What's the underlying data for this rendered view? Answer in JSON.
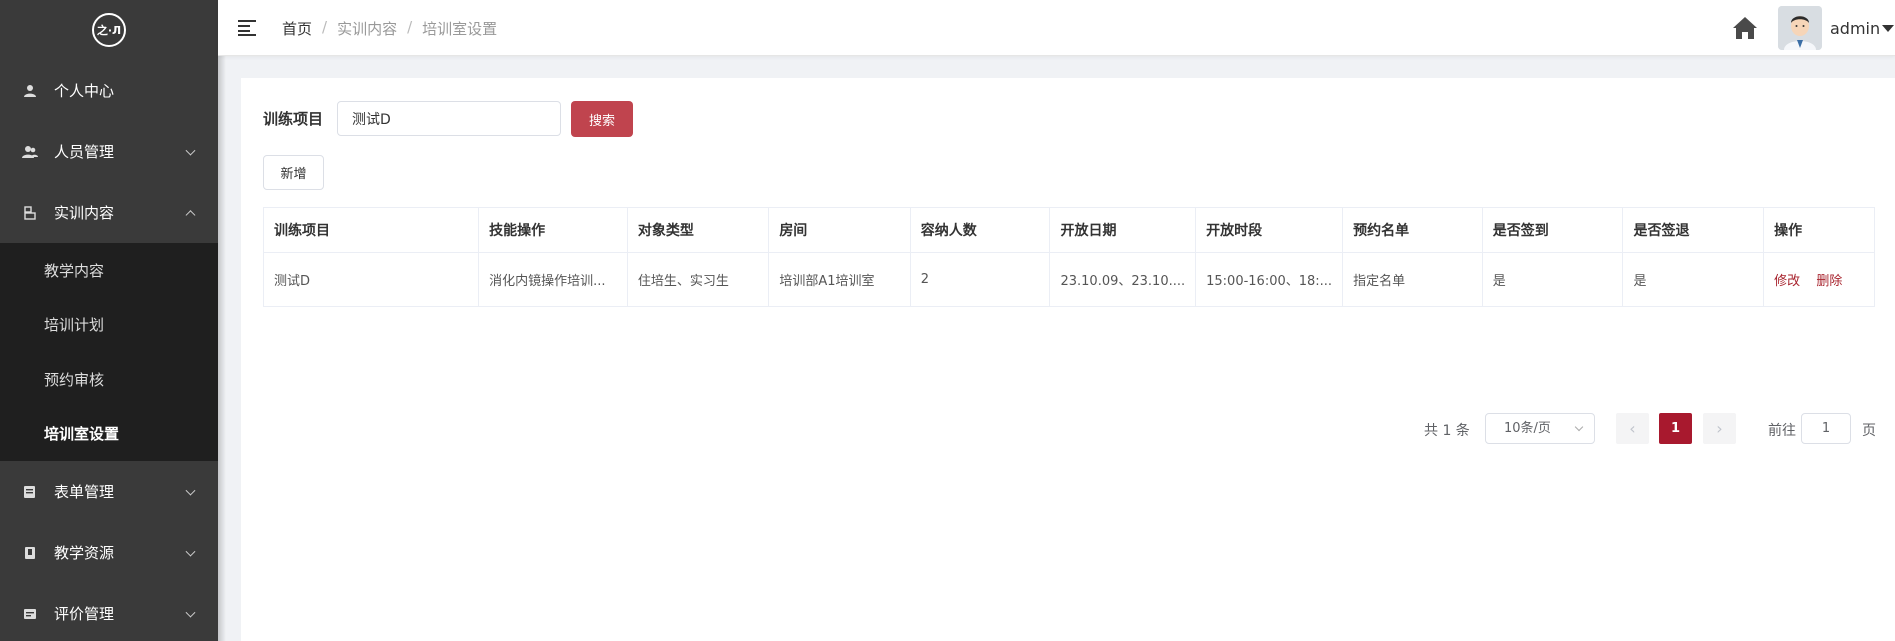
{
  "sidebar": {
    "logo_text": "之·Л",
    "items": [
      {
        "label": "个人中心",
        "icon": "user-icon",
        "has_children": false
      },
      {
        "label": "人员管理",
        "icon": "users-icon",
        "has_children": true
      },
      {
        "label": "实训内容",
        "icon": "training-icon",
        "has_children": true,
        "expanded": true,
        "children": [
          {
            "label": "教学内容"
          },
          {
            "label": "培训计划"
          },
          {
            "label": "预约审核"
          },
          {
            "label": "培训室设置",
            "active": true
          }
        ]
      },
      {
        "label": "表单管理",
        "icon": "form-icon",
        "has_children": true
      },
      {
        "label": "教学资源",
        "icon": "resource-icon",
        "has_children": true
      },
      {
        "label": "评价管理",
        "icon": "evaluation-icon",
        "has_children": true
      }
    ]
  },
  "header": {
    "breadcrumb": [
      "首页",
      "实训内容",
      "培训室设置"
    ],
    "separator": "/",
    "user_name": "admin"
  },
  "search": {
    "label": "训练项目",
    "value": "测试D",
    "search_button": "搜索",
    "add_button": "新增"
  },
  "table": {
    "columns": [
      "训练项目",
      "技能操作",
      "对象类型",
      "房间",
      "容纳人数",
      "开放日期",
      "开放时段",
      "预约名单",
      "是否签到",
      "是否签退",
      "操作"
    ],
    "rows": [
      {
        "cells": [
          "测试D",
          "消化内镜操作培训...",
          "住培生、实习生",
          "培训部A1培训室",
          "2",
          "23.10.09、23.10....",
          "15:00-16:00、18:...",
          "指定名单",
          "是",
          "是"
        ],
        "actions": [
          "修改",
          "删除"
        ]
      }
    ]
  },
  "pagination": {
    "total_text": "共 1 条",
    "page_size": "10条/页",
    "current_page": "1",
    "goto_label": "前往",
    "goto_value": "1",
    "page_suffix": "页"
  },
  "colors": {
    "sidebar_bg": "#3a3a3a",
    "submenu_bg": "#1f1f1f",
    "primary": "#c0444e",
    "active_page": "#a8192e",
    "link": "#a8242e"
  }
}
